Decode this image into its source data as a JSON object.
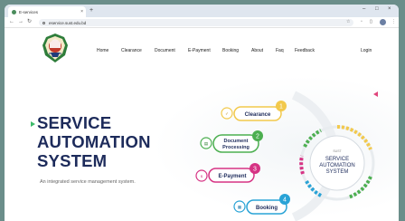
{
  "browser": {
    "tab_title": "E-services",
    "tab_close": "×",
    "new_tab": "+",
    "url": "eservice.sust.edu.bd",
    "window_controls": [
      "–",
      "□",
      "×"
    ]
  },
  "header": {
    "nav": [
      "Home",
      "Clearance",
      "Document",
      "E-Payment",
      "Booking",
      "About",
      "Faq",
      "Feedback"
    ],
    "login": "Login"
  },
  "hero": {
    "title_line1": "SERVICE",
    "title_line2": "AUTOMATION",
    "title_line3": "SYSTEM",
    "subtitle": "An integrated service management system."
  },
  "diagram": {
    "center_small": "SUST",
    "center_line1": "SERVICE",
    "center_line2": "AUTOMATION",
    "center_line3": "SYSTEM",
    "items": [
      {
        "number": "1",
        "label": "Clearance",
        "color": "#f2c94c"
      },
      {
        "number": "2",
        "label_line1": "Document",
        "label_line2": "Processing",
        "color": "#4caf50"
      },
      {
        "number": "3",
        "label": "E-Payment",
        "color": "#d63384"
      },
      {
        "number": "4",
        "label": "Booking",
        "color": "#29a3d6"
      }
    ]
  },
  "colors": {
    "title": "#1d2b5b",
    "accent_green": "#3dbb6a",
    "accent_pink": "#e0457b"
  }
}
